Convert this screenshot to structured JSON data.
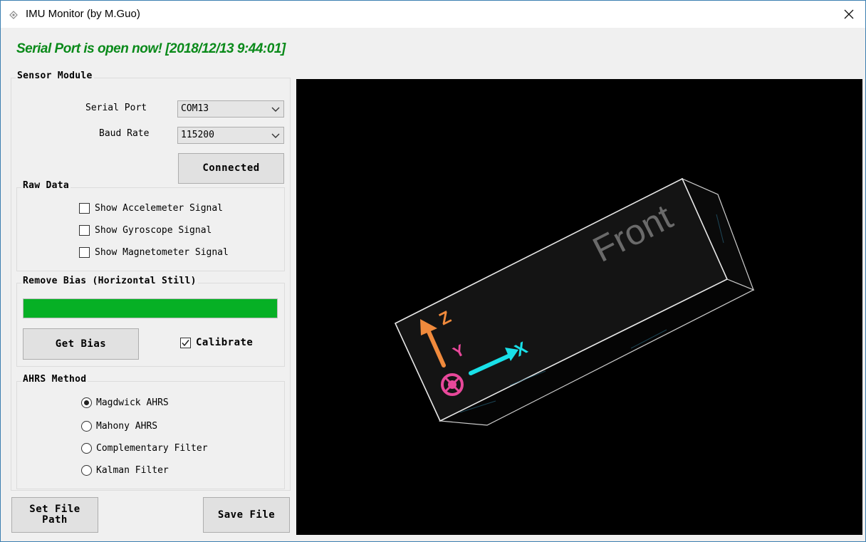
{
  "window": {
    "title": "IMU Monitor (by M.Guo)"
  },
  "status_text": "Serial Port is open now! [2018/12/13 9:44:01]",
  "sensor_module": {
    "legend": "Sensor Module",
    "serial_port_label": "Serial Port",
    "serial_port_value": "COM13",
    "baud_rate_label": "Baud Rate",
    "baud_rate_value": "115200",
    "connect_button": "Connected"
  },
  "raw_data": {
    "legend": "Raw Data",
    "items": [
      {
        "label": "Show Accelemeter Signal",
        "checked": false
      },
      {
        "label": "Show Gyroscope Signal",
        "checked": false
      },
      {
        "label": "Show Magnetometer Signal",
        "checked": false
      }
    ]
  },
  "remove_bias": {
    "legend": "Remove Bias (Horizontal Still)",
    "progress": 1.0,
    "get_bias_button": "Get Bias",
    "calibrate_label": "Calibrate",
    "calibrate_checked": true
  },
  "ahrs": {
    "legend": "AHRS Method",
    "options": [
      {
        "label": "Magdwick AHRS",
        "selected": true
      },
      {
        "label": "Mahony AHRS",
        "selected": false
      },
      {
        "label": "Complementary Filter",
        "selected": false
      },
      {
        "label": "Kalman Filter",
        "selected": false
      }
    ]
  },
  "footer": {
    "set_file_path_button": "Set File Path",
    "save_file_button": "Save File"
  },
  "viewport": {
    "front_label": "Front",
    "axis_z": "Z",
    "axis_y": "Y",
    "axis_x": "X",
    "colors": {
      "z": "#f08a3c",
      "y": "#e8489a",
      "x": "#19e0e8",
      "progress": "#06b025",
      "status": "#0a8a1a"
    }
  }
}
